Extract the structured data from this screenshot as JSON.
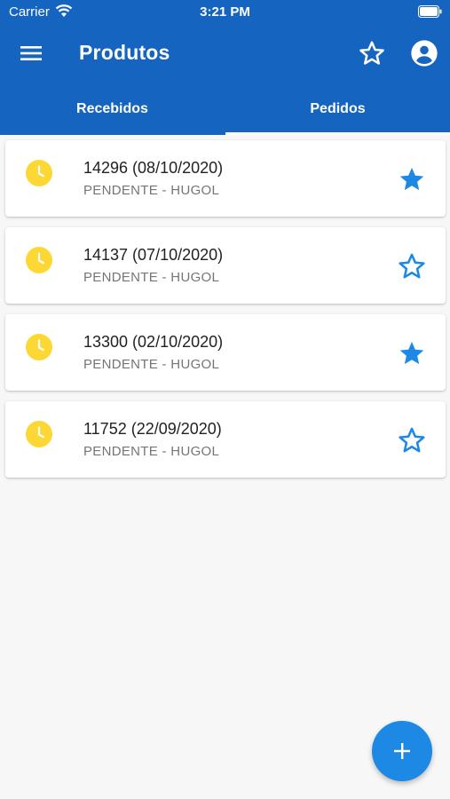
{
  "status_bar": {
    "carrier": "Carrier",
    "time": "3:21 PM"
  },
  "app_bar": {
    "title": "Produtos"
  },
  "tabs": [
    {
      "label": "Recebidos",
      "selected": false
    },
    {
      "label": "Pedidos",
      "selected": true
    }
  ],
  "orders": [
    {
      "title": "14296 (08/10/2020)",
      "status": "PENDENTE - HUGOL",
      "favorite": true
    },
    {
      "title": "14137 (07/10/2020)",
      "status": "PENDENTE - HUGOL",
      "favorite": false
    },
    {
      "title": "13300 (02/10/2020)",
      "status": "PENDENTE - HUGOL",
      "favorite": true
    },
    {
      "title": "11752 (22/09/2020)",
      "status": "PENDENTE - HUGOL",
      "favorite": false
    }
  ],
  "colors": {
    "primary": "#1565c0",
    "accent": "#1e88e5",
    "pending": "#fdd835"
  },
  "icons": {
    "menu": "menu-icon",
    "favorites": "star-outline-icon",
    "account": "account-circle-icon",
    "status": "clock-icon",
    "fab": "plus-icon"
  }
}
